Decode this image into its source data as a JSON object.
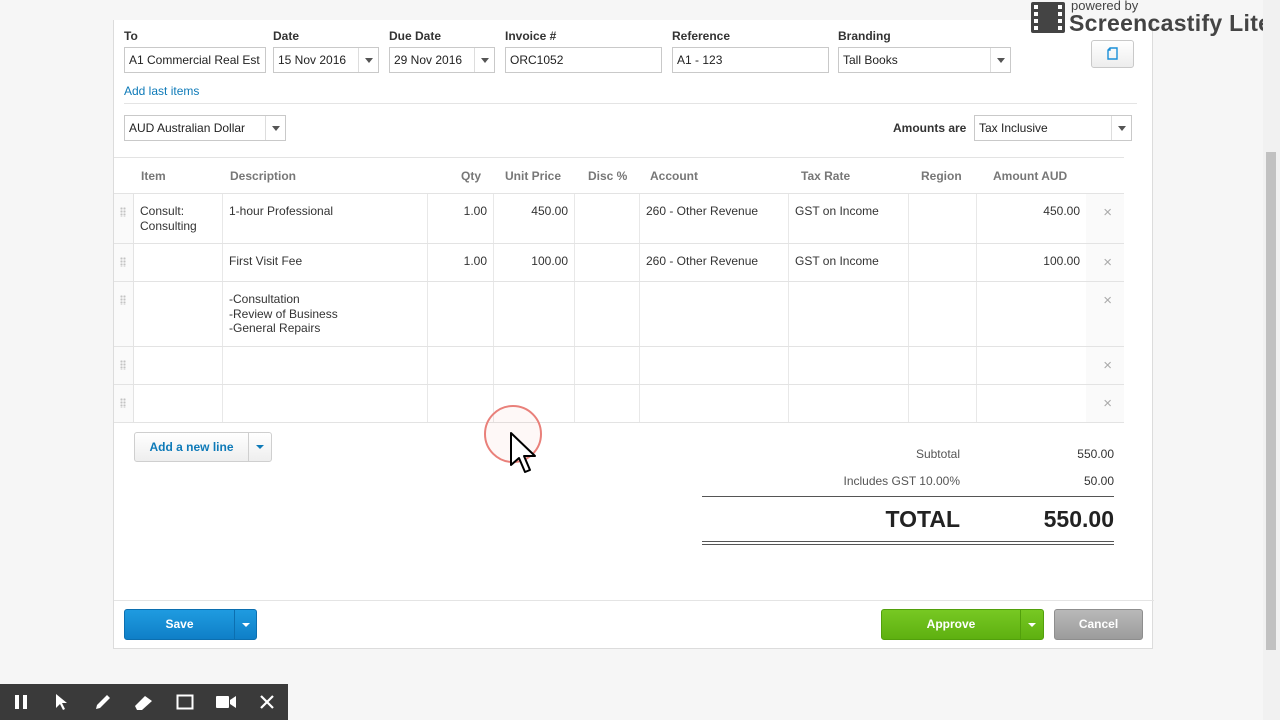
{
  "header": {
    "to": {
      "label": "To",
      "value": "A1 Commercial Real Est"
    },
    "date": {
      "label": "Date",
      "value": "15 Nov 2016"
    },
    "due_date": {
      "label": "Due Date",
      "value": "29 Nov 2016"
    },
    "invoice_no": {
      "label": "Invoice #",
      "value": "ORC1052"
    },
    "reference": {
      "label": "Reference",
      "value": "A1 - 123"
    },
    "branding": {
      "label": "Branding",
      "value": "Tall Books"
    },
    "branding_icon": "copy-document-icon"
  },
  "add_last_items": "Add last items",
  "currency": "AUD Australian Dollar",
  "amounts_are": {
    "label": "Amounts are",
    "value": "Tax Inclusive"
  },
  "table": {
    "columns": [
      "Item",
      "Description",
      "Qty",
      "Unit Price",
      "Disc %",
      "Account",
      "Tax Rate",
      "Region",
      "Amount AUD"
    ],
    "rows": [
      {
        "item": "Consult: Consulting",
        "description": "1-hour Professional",
        "qty": "1.00",
        "unit_price": "450.00",
        "disc": "",
        "account": "260 - Other Revenue",
        "tax_rate": "GST on Income",
        "region": "",
        "amount": "450.00"
      },
      {
        "item": "",
        "description": "First Visit Fee",
        "qty": "1.00",
        "unit_price": "100.00",
        "disc": "",
        "account": "260 - Other Revenue",
        "tax_rate": "GST on Income",
        "region": "",
        "amount": "100.00"
      },
      {
        "item": "",
        "description": "-Consultation\n-Review of Business\n-General Repairs",
        "qty": "",
        "unit_price": "",
        "disc": "",
        "account": "",
        "tax_rate": "",
        "region": "",
        "amount": ""
      },
      {
        "item": "",
        "description": "",
        "qty": "",
        "unit_price": "",
        "disc": "",
        "account": "",
        "tax_rate": "",
        "region": "",
        "amount": ""
      },
      {
        "item": "",
        "description": "",
        "qty": "",
        "unit_price": "",
        "disc": "",
        "account": "",
        "tax_rate": "",
        "region": "",
        "amount": ""
      }
    ],
    "remove_glyph": "×"
  },
  "add_new_line": "Add a new line",
  "totals": {
    "subtotal_label": "Subtotal",
    "subtotal": "550.00",
    "gst_label": "Includes GST 10.00%",
    "gst": "50.00",
    "total_label": "TOTAL",
    "total": "550.00"
  },
  "footer": {
    "save": "Save",
    "approve": "Approve",
    "cancel": "Cancel"
  },
  "watermark": {
    "small": "powered by",
    "big": "Screencastify Lite"
  },
  "recording_toolbar": [
    "pause-icon",
    "pointer-icon",
    "pen-icon",
    "eraser-icon",
    "rectangle-icon",
    "camera-icon",
    "close-icon"
  ],
  "colors": {
    "link": "#0e7ab8",
    "save": "#1a8fd8",
    "approve": "#6abf19",
    "cancel": "#a8a8a8"
  }
}
